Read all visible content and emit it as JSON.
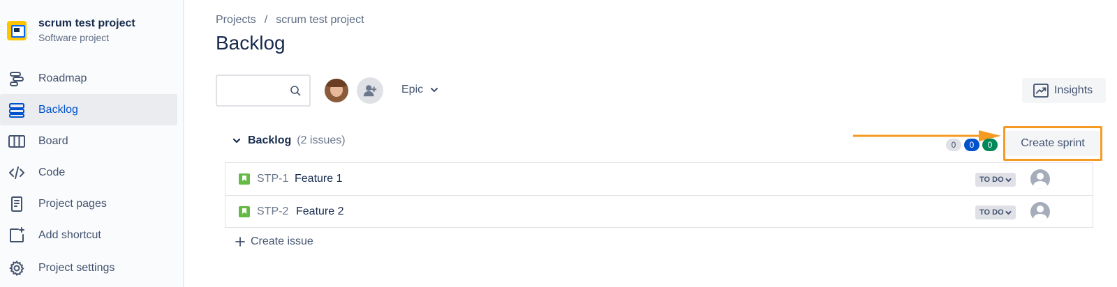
{
  "project": {
    "name": "scrum test project",
    "type": "Software project"
  },
  "sidebar": {
    "items": [
      {
        "label": "Roadmap",
        "icon": "roadmap-icon"
      },
      {
        "label": "Backlog",
        "icon": "backlog-icon",
        "active": true
      },
      {
        "label": "Board",
        "icon": "board-icon"
      },
      {
        "label": "Code",
        "icon": "code-icon"
      },
      {
        "label": "Project pages",
        "icon": "page-icon"
      },
      {
        "label": "Add shortcut",
        "icon": "add-shortcut-icon"
      },
      {
        "label": "Project settings",
        "icon": "gear-icon"
      }
    ]
  },
  "breadcrumb": {
    "root": "Projects",
    "separator": "/",
    "current": "scrum test project"
  },
  "page": {
    "title": "Backlog"
  },
  "toolbar": {
    "search_placeholder": "",
    "epic_label": "Epic",
    "insights_label": "Insights"
  },
  "backlog": {
    "title": "Backlog",
    "count_label": "(2 issues)",
    "badges": [
      "0",
      "0",
      "0"
    ],
    "create_sprint_label": "Create sprint",
    "issues": [
      {
        "key": "STP-1",
        "summary": "Feature 1",
        "status": "TO DO"
      },
      {
        "key": "STP-2",
        "summary": "Feature 2",
        "status": "TO DO"
      }
    ],
    "create_issue_label": "Create issue"
  },
  "colors": {
    "accent": "#0052cc",
    "highlight": "#f59a23",
    "story": "#65ba43",
    "done_badge": "#00875a"
  }
}
